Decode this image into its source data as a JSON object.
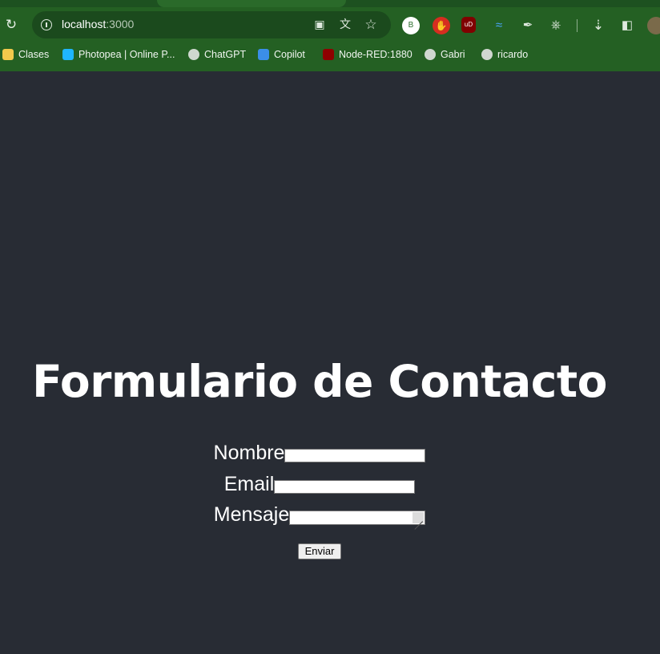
{
  "browser": {
    "url_host": "localhost",
    "url_port": ":3000",
    "bookmarks": [
      {
        "label": "Clases",
        "icon": "classroom-icon",
        "color": "#f2c94c"
      },
      {
        "label": "Photopea | Online P...",
        "icon": "photopea-icon",
        "color": "#1fb6ff"
      },
      {
        "label": "ChatGPT",
        "icon": "chatgpt-icon",
        "color": "#cfd8cf"
      },
      {
        "label": "Copilot",
        "icon": "copilot-icon",
        "color": "#3b8ee8"
      },
      {
        "label": "Node-RED:1880",
        "icon": "node-red-icon",
        "color": "#8f0000"
      },
      {
        "label": "Gabri",
        "icon": "github-icon",
        "color": "#d0d7d0"
      },
      {
        "label": "ricardo",
        "icon": "github-icon",
        "color": "#d0d7d0"
      }
    ],
    "extension_b_label": "B",
    "extension_ud_label": "uD"
  },
  "page": {
    "background": "#282c34",
    "title": "Formulario de Contacto",
    "form": {
      "name_label": "Nombre",
      "email_label": "Email",
      "message_label": "Mensaje",
      "name_value": "",
      "email_value": "",
      "message_value": "",
      "submit_label": "Enviar"
    }
  }
}
